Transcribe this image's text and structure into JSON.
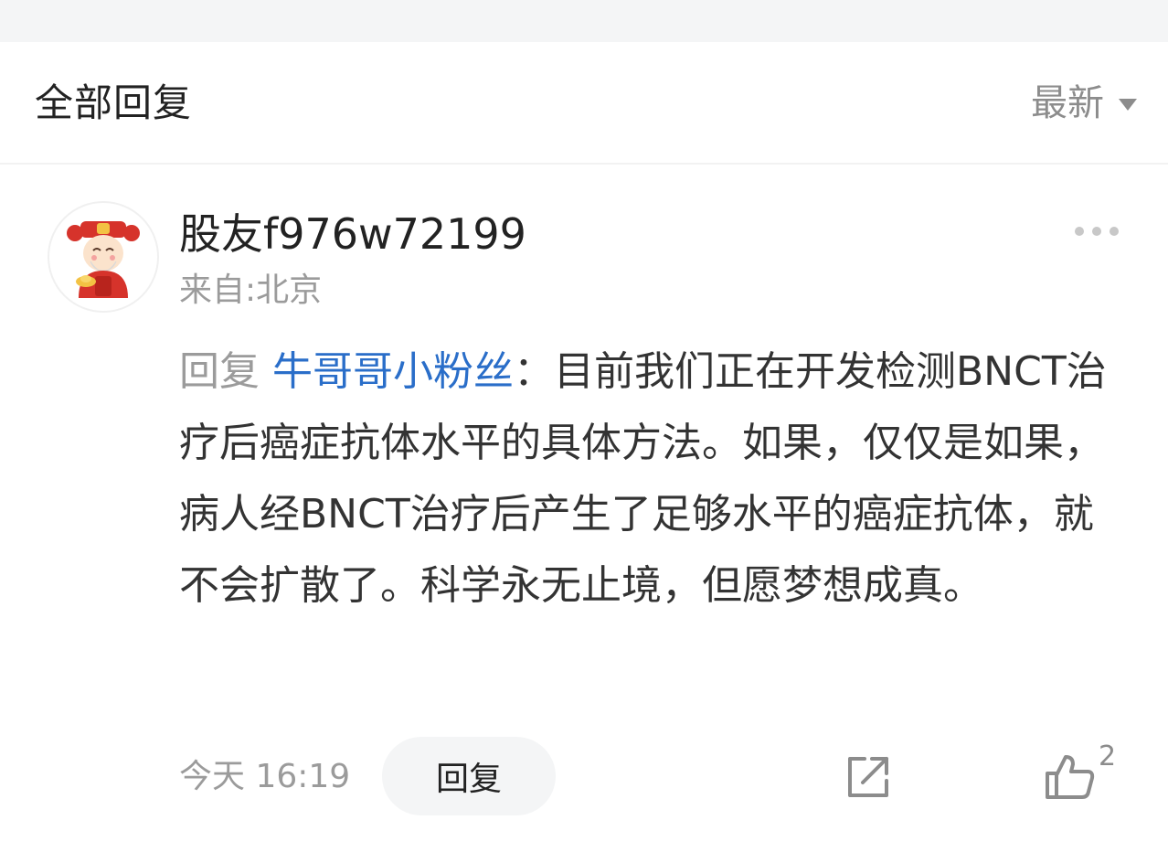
{
  "header": {
    "title": "全部回复",
    "sort_label": "最新"
  },
  "comment": {
    "username": "股友f976w72199",
    "location": "来自:北京",
    "reply_prefix": "回复",
    "reply_target": "牛哥哥小粉丝",
    "reply_separator": "：",
    "text": "目前我们正在开发检测BNCT治疗后癌症抗体水平的具体方法。如果，仅仅是如果，病人经BNCT治疗后产生了足够水平的癌症抗体，就不会扩散了。科学永无止境，但愿梦想成真。",
    "time": "今天 16:19",
    "reply_button": "回复",
    "like_count": "2"
  },
  "icons": {
    "sort": "caret-down-icon",
    "more": "more-dots-icon",
    "share": "share-icon",
    "like": "thumbs-up-icon",
    "avatar": "avatar-image"
  },
  "colors": {
    "link": "#2a6ec9",
    "muted": "#9b9b9b",
    "text": "#333333",
    "button_bg": "#f4f5f6"
  }
}
